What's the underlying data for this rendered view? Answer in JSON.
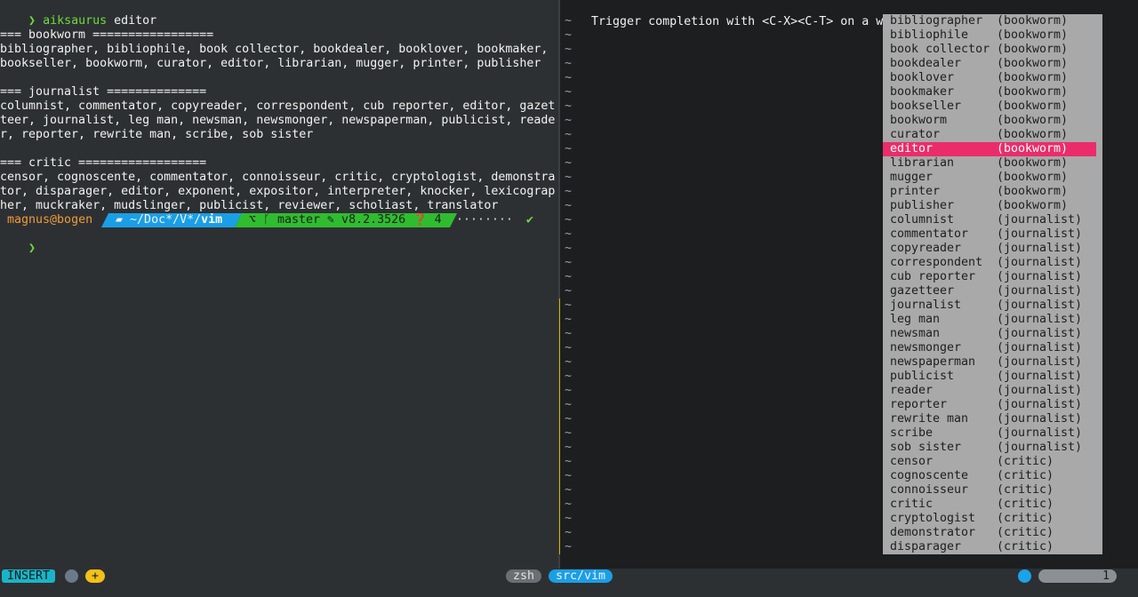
{
  "left": {
    "cmd_arrow": "❯",
    "cmd_name": "aiksaurus",
    "cmd_arg": " editor",
    "output_lines": [
      "",
      "=== bookworm =================",
      "bibliographer, bibliophile, book collector, bookdealer, booklover, bookmaker,",
      "bookseller, bookworm, curator, editor, librarian, mugger, printer, publisher",
      "",
      "=== journalist ==============",
      "columnist, commentator, copyreader, correspondent, cub reporter, editor, gazet",
      "teer, journalist, leg man, newsman, newsmonger, newspaperman, publicist, reade",
      "r, reporter, rewrite man, scribe, sob sister",
      "",
      "=== critic ==================",
      "censor, cognoscente, commentator, connoisseur, critic, cryptologist, demonstra",
      "tor, disparager, editor, exponent, expositor, interpreter, knocker, lexicograp",
      "her, muckraker, mudslinger, publicist, reviewer, scholiast, translator"
    ],
    "prompt": {
      "user_host": "magnus@bogen",
      "dir_prefix": "~/Doc*/V*/",
      "dir_current": "vim",
      "git_text": "⌥ ᚴ master ✎ v8.2.3526 ❓ 4",
      "dots": "········",
      "check": "✔",
      "next_arrow": "❯"
    }
  },
  "vim": {
    "command_line": "Trigger completion with <C-X><C-T> on a word: editor",
    "tilde": "~",
    "menu": [
      {
        "word": "bibliographer",
        "kind": "(bookworm)"
      },
      {
        "word": "bibliophile",
        "kind": "(bookworm)"
      },
      {
        "word": "book collector",
        "kind": "(bookworm)"
      },
      {
        "word": "bookdealer",
        "kind": "(bookworm)"
      },
      {
        "word": "booklover",
        "kind": "(bookworm)"
      },
      {
        "word": "bookmaker",
        "kind": "(bookworm)"
      },
      {
        "word": "bookseller",
        "kind": "(bookworm)"
      },
      {
        "word": "bookworm",
        "kind": "(bookworm)"
      },
      {
        "word": "curator",
        "kind": "(bookworm)"
      },
      {
        "word": "editor",
        "kind": "(bookworm)",
        "selected": true
      },
      {
        "word": "librarian",
        "kind": "(bookworm)"
      },
      {
        "word": "mugger",
        "kind": "(bookworm)"
      },
      {
        "word": "printer",
        "kind": "(bookworm)"
      },
      {
        "word": "publisher",
        "kind": "(bookworm)"
      },
      {
        "word": "columnist",
        "kind": "(journalist)"
      },
      {
        "word": "commentator",
        "kind": "(journalist)"
      },
      {
        "word": "copyreader",
        "kind": "(journalist)"
      },
      {
        "word": "correspondent",
        "kind": "(journalist)"
      },
      {
        "word": "cub reporter",
        "kind": "(journalist)"
      },
      {
        "word": "gazetteer",
        "kind": "(journalist)"
      },
      {
        "word": "journalist",
        "kind": "(journalist)"
      },
      {
        "word": "leg man",
        "kind": "(journalist)"
      },
      {
        "word": "newsman",
        "kind": "(journalist)"
      },
      {
        "word": "newsmonger",
        "kind": "(journalist)"
      },
      {
        "word": "newspaperman",
        "kind": "(journalist)"
      },
      {
        "word": "publicist",
        "kind": "(journalist)"
      },
      {
        "word": "reader",
        "kind": "(journalist)"
      },
      {
        "word": "reporter",
        "kind": "(journalist)"
      },
      {
        "word": "rewrite man",
        "kind": "(journalist)"
      },
      {
        "word": "scribe",
        "kind": "(journalist)"
      },
      {
        "word": "sob sister",
        "kind": "(journalist)"
      },
      {
        "word": "censor",
        "kind": "(critic)"
      },
      {
        "word": "cognoscente",
        "kind": "(critic)"
      },
      {
        "word": "connoisseur",
        "kind": "(critic)"
      },
      {
        "word": "critic",
        "kind": "(critic)"
      },
      {
        "word": "cryptologist",
        "kind": "(critic)"
      },
      {
        "word": "demonstrator",
        "kind": "(critic)"
      },
      {
        "word": "disparager",
        "kind": "(critic)"
      }
    ],
    "selected_color": "#ea2d6a"
  },
  "status": {
    "mode": "INSERT",
    "plus": "+",
    "tab_zsh": "zsh",
    "tab_vim": "src/vim",
    "line": "1"
  }
}
